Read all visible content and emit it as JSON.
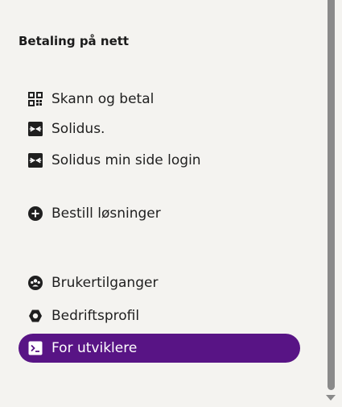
{
  "section": {
    "title": "Betaling på nett"
  },
  "items": [
    {
      "label": "Skann og betal",
      "icon": "qr-code-icon"
    },
    {
      "label": "Solidus.",
      "icon": "login-arrow-icon"
    },
    {
      "label": "Solidus min side login",
      "icon": "login-arrow-icon"
    },
    {
      "label": "Bestill løsninger",
      "icon": "plus-circle-icon"
    },
    {
      "label": "Brukertilganger",
      "icon": "users-icon"
    },
    {
      "label": "Bedriftsprofil",
      "icon": "hexagon-icon"
    },
    {
      "label": "For utviklere",
      "icon": "terminal-icon",
      "active": true
    }
  ],
  "colors": {
    "accent": "#581485",
    "background": "#f4f3f0",
    "scrollbar": "#8a8a8a"
  }
}
